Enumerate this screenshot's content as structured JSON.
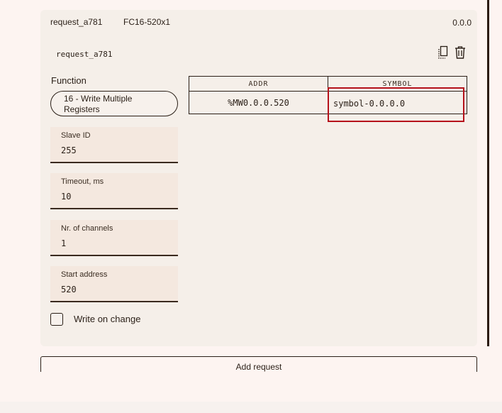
{
  "request": {
    "name": "request_a781",
    "function_code": "FC16-520x1",
    "version": "0.0.0",
    "id_label": "request_a781"
  },
  "function": {
    "label": "Function",
    "selected": "16 - Write Multiple Registers"
  },
  "fields": {
    "slave_id": {
      "label": "Slave ID",
      "value": "255"
    },
    "timeout": {
      "label": "Timeout, ms",
      "value": "10"
    },
    "channels": {
      "label": "Nr. of channels",
      "value": "1"
    },
    "start_address": {
      "label": "Start address",
      "value": "520"
    }
  },
  "write_on_change": {
    "label": "Write on change",
    "checked": false
  },
  "table": {
    "headers": [
      "ADDR",
      "SYMBOL"
    ],
    "rows": [
      {
        "addr": "%MW0.0.0.520",
        "symbol": "symbol-0.0.0.0"
      }
    ]
  },
  "icons": {
    "copy": "copy-icon",
    "delete": "trash-icon"
  },
  "add_request_label": "Add request",
  "colors": {
    "highlight": "#b5121b",
    "field_bg": "#f4e8df",
    "card_bg": "#f5efe9"
  }
}
